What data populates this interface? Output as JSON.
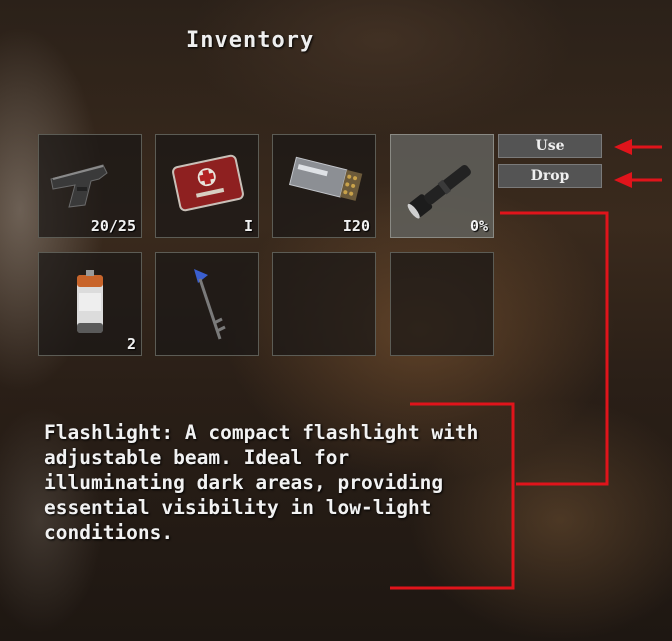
{
  "inventory": {
    "title": "Inventory",
    "slots": [
      {
        "item": "pistol",
        "count": "20/25",
        "selected": false
      },
      {
        "item": "first-aid-kit",
        "count": "I",
        "selected": false
      },
      {
        "item": "ammo-box",
        "count": "I20",
        "selected": false
      },
      {
        "item": "flashlight",
        "count": "0%",
        "selected": true
      },
      {
        "item": "battery",
        "count": "2",
        "selected": false
      },
      {
        "item": "key",
        "count": "",
        "selected": false
      },
      {
        "item": "empty",
        "count": "",
        "selected": false
      },
      {
        "item": "empty",
        "count": "",
        "selected": false
      }
    ],
    "actions": {
      "use_label": "Use",
      "drop_label": "Drop"
    },
    "description": "Flashlight: A compact flashlight with adjustable beam. Ideal for illuminating dark areas, providing essential visibility in low-light conditions."
  },
  "annotation_color": "#e0141b"
}
